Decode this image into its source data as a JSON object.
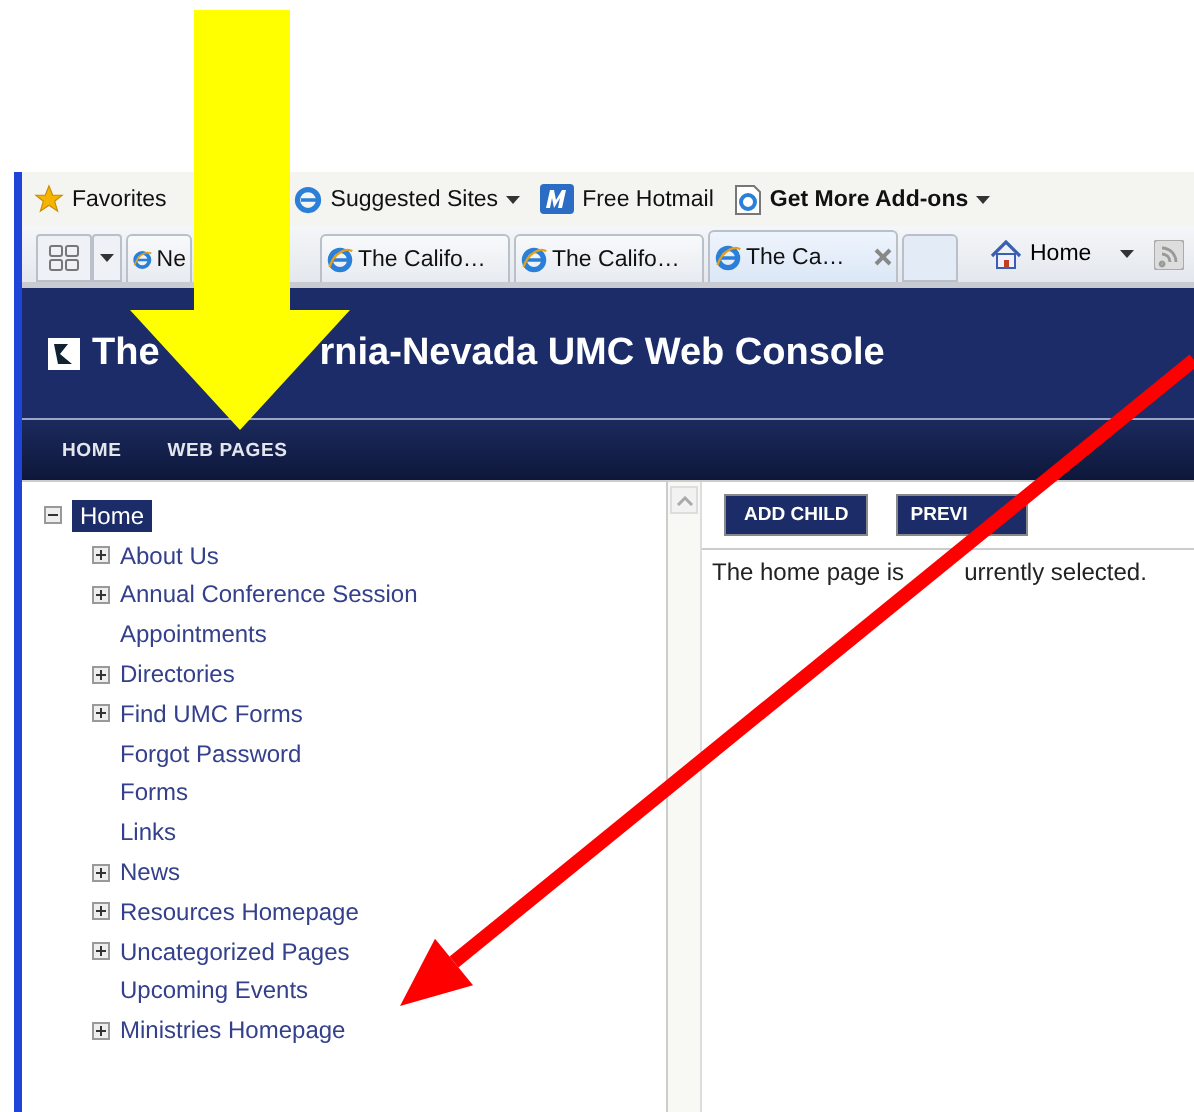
{
  "favorites_bar": [
    {
      "kind": "favorites",
      "label": "Favorites",
      "dropdown": false
    },
    {
      "kind": "site",
      "label": "Suggested Sites",
      "dropdown": true
    },
    {
      "kind": "hotmail",
      "label": "Free Hotmail",
      "dropdown": false
    },
    {
      "kind": "addons",
      "label": "Get More Add-ons",
      "dropdown": true
    }
  ],
  "tabs": [
    {
      "label": "Ne",
      "selected": false
    },
    {
      "label": "The Califo…",
      "selected": false
    },
    {
      "label": "The Califo…",
      "selected": false
    },
    {
      "label": "The Ca…",
      "selected": true
    }
  ],
  "command_bar": {
    "home": "Home"
  },
  "site_header": {
    "title_parts": [
      "The",
      "rnia-Nevada UMC Web Console"
    ]
  },
  "nav": [
    {
      "label": "HOME"
    },
    {
      "label": "WEB PAGES"
    }
  ],
  "tree": {
    "label": "Home",
    "selected": true,
    "expanded": true,
    "children": [
      {
        "label": "About Us",
        "expandable": true,
        "selected": false
      },
      {
        "label": "Annual Conference Session",
        "expandable": true,
        "selected": false
      },
      {
        "label": "Appointments",
        "expandable": false,
        "selected": false
      },
      {
        "label": "Directories",
        "expandable": true,
        "selected": false
      },
      {
        "label": "Find UMC Forms",
        "expandable": true,
        "selected": false
      },
      {
        "label": "Forgot Password",
        "expandable": false,
        "selected": false
      },
      {
        "label": "Forms",
        "expandable": false,
        "selected": false
      },
      {
        "label": "Links",
        "expandable": false,
        "selected": false
      },
      {
        "label": "News",
        "expandable": true,
        "selected": false
      },
      {
        "label": "Resources Homepage",
        "expandable": true,
        "selected": false
      },
      {
        "label": "Uncategorized Pages",
        "expandable": true,
        "selected": false
      },
      {
        "label": "Upcoming Events",
        "expandable": false,
        "selected": false
      },
      {
        "label": "Ministries Homepage",
        "expandable": true,
        "selected": false
      }
    ]
  },
  "toolbar": [
    "ADD CHILD",
    "PREVI"
  ],
  "message_parts": [
    "The home page is",
    "urrently selected."
  ]
}
